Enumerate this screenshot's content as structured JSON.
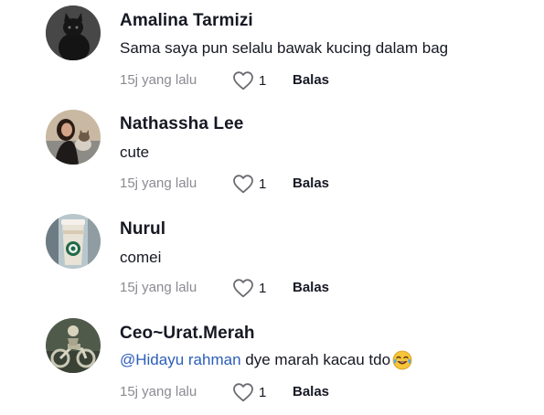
{
  "comments": [
    {
      "username": "Amalina Tarmizi",
      "text": "Sama saya pun selalu bawak kucing dalam bag",
      "time": "15j yang lalu",
      "likes": "1",
      "reply_label": "Balas",
      "avatar_icon": "black-cat-avatar"
    },
    {
      "username": "Nathassha Lee",
      "text": "cute",
      "time": "15j yang lalu",
      "likes": "1",
      "reply_label": "Balas",
      "avatar_icon": "woman-with-cat-avatar"
    },
    {
      "username": "Nurul",
      "text": "comei",
      "time": "15j yang lalu",
      "likes": "1",
      "reply_label": "Balas",
      "avatar_icon": "coffee-cup-avatar"
    },
    {
      "username": "Ceo~Urat.Merah",
      "mention": "@Hidayu rahman",
      "text": "dye marah kacau tdo",
      "emoji": "crying-laughing-emoji",
      "time": "15j yang lalu",
      "likes": "1",
      "reply_label": "Balas",
      "avatar_icon": "motorcycle-rider-avatar"
    }
  ],
  "colors": {
    "text": "#161823",
    "muted": "#8a8b91",
    "mention": "#2b5db9"
  }
}
